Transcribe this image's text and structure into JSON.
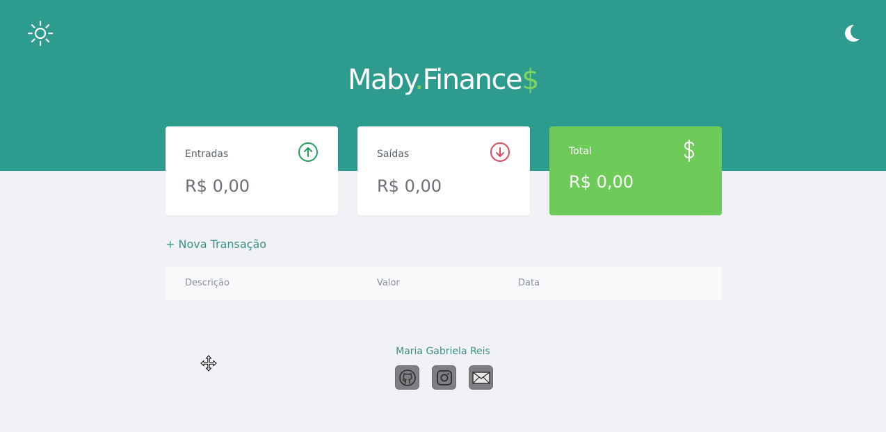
{
  "header": {
    "logo_main": "Maby",
    "logo_dot": ".",
    "logo_finance": "Finance",
    "logo_symbol": "$",
    "light_theme_icon": "sun-icon",
    "dark_theme_icon": "moon-icon"
  },
  "cards": [
    {
      "label": "Entradas",
      "value": "R$ 0,00",
      "icon": "arrow-up-circle-icon",
      "icon_color": "#1fa05a"
    },
    {
      "label": "Saídas",
      "value": "R$ 0,00",
      "icon": "arrow-down-circle-icon",
      "icon_color": "#e0475b"
    },
    {
      "label": "Total",
      "value": "R$ 0,00",
      "icon": "dollar-icon",
      "icon_color": "#ffffff"
    }
  ],
  "actions": {
    "new_transaction": "+ Nova Transação"
  },
  "table": {
    "columns": [
      "Descrição",
      "Valor",
      "Data"
    ],
    "rows": []
  },
  "footer": {
    "author": "Maria Gabriela Reis",
    "socials": [
      "github-icon",
      "instagram-icon",
      "mail-icon"
    ]
  },
  "colors": {
    "header_bg": "#2d9b8e",
    "accent_green": "#6fcb59",
    "page_bg": "#f0f2f5"
  }
}
